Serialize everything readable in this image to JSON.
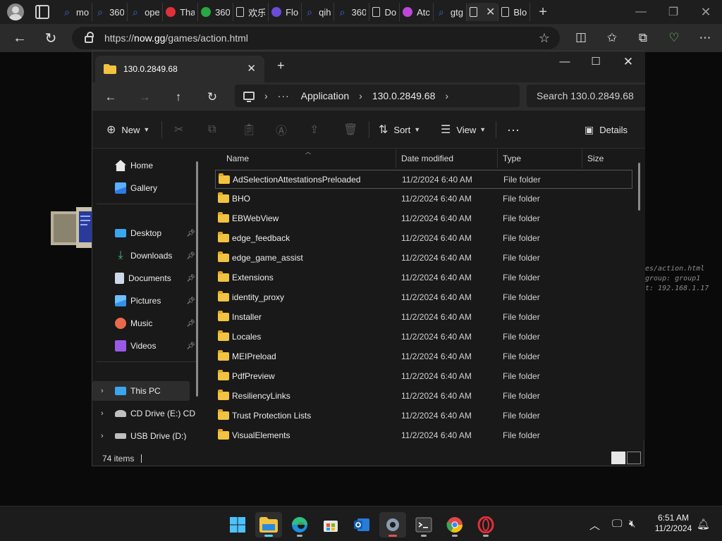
{
  "browser": {
    "tabs": [
      {
        "label": "mo",
        "icon": "search-icon",
        "color": "#3c6fd8"
      },
      {
        "label": "360",
        "icon": "search-icon",
        "color": "#3c6fd8"
      },
      {
        "label": "ope",
        "icon": "search-icon",
        "color": "#3c6fd8"
      },
      {
        "label": "Tha",
        "icon": "opera-icon",
        "color": "#e0303a"
      },
      {
        "label": "360",
        "icon": "chatgpt-icon",
        "color": "#28a745"
      },
      {
        "label": "欢乐",
        "icon": "page-icon",
        "color": "#cfcfcf"
      },
      {
        "label": "Flo",
        "icon": "flo-icon",
        "color": "#6a4cd8"
      },
      {
        "label": "qih",
        "icon": "search-icon",
        "color": "#3c6fd8"
      },
      {
        "label": "360",
        "icon": "search-icon",
        "color": "#3c6fd8"
      },
      {
        "label": "Do",
        "icon": "page-icon",
        "color": "#cfcfcf"
      },
      {
        "label": "Atc",
        "icon": "copilot-icon",
        "color": "#c046d8"
      },
      {
        "label": "gtg",
        "icon": "search-icon",
        "color": "#3c6fd8"
      },
      {
        "label": "Blo",
        "icon": "page-icon",
        "color": "#cfcfcf"
      }
    ],
    "url_prefix": "https://",
    "url_host": "now.gg",
    "url_path": "/games/action.html"
  },
  "page": {
    "side_text": [
      "es/action.html",
      "group: group1",
      "t: 192.168.1.17"
    ]
  },
  "explorer": {
    "tab_title": "130.0.2849.68",
    "breadcrumb": [
      "Application",
      "130.0.2849.68"
    ],
    "search_placeholder": "Search 130.0.2849.68",
    "commands": {
      "new": "New",
      "sort": "Sort",
      "view": "View",
      "details": "Details"
    },
    "nav": {
      "home": "Home",
      "gallery": "Gallery",
      "desktop": "Desktop",
      "downloads": "Downloads",
      "documents": "Documents",
      "pictures": "Pictures",
      "music": "Music",
      "videos": "Videos",
      "this_pc": "This PC",
      "cd_drive": "CD Drive (E:) CD",
      "usb_drive": "USB Drive (D:)"
    },
    "columns": {
      "name": "Name",
      "date": "Date modified",
      "type": "Type",
      "size": "Size"
    },
    "rows": [
      {
        "name": "AdSelectionAttestationsPreloaded",
        "date": "11/2/2024 6:40 AM",
        "type": "File folder"
      },
      {
        "name": "BHO",
        "date": "11/2/2024 6:40 AM",
        "type": "File folder"
      },
      {
        "name": "EBWebView",
        "date": "11/2/2024 6:40 AM",
        "type": "File folder"
      },
      {
        "name": "edge_feedback",
        "date": "11/2/2024 6:40 AM",
        "type": "File folder"
      },
      {
        "name": "edge_game_assist",
        "date": "11/2/2024 6:40 AM",
        "type": "File folder"
      },
      {
        "name": "Extensions",
        "date": "11/2/2024 6:40 AM",
        "type": "File folder"
      },
      {
        "name": "identity_proxy",
        "date": "11/2/2024 6:40 AM",
        "type": "File folder"
      },
      {
        "name": "Installer",
        "date": "11/2/2024 6:40 AM",
        "type": "File folder"
      },
      {
        "name": "Locales",
        "date": "11/2/2024 6:40 AM",
        "type": "File folder"
      },
      {
        "name": "MEIPreload",
        "date": "11/2/2024 6:40 AM",
        "type": "File folder"
      },
      {
        "name": "PdfPreview",
        "date": "11/2/2024 6:40 AM",
        "type": "File folder"
      },
      {
        "name": "ResiliencyLinks",
        "date": "11/2/2024 6:40 AM",
        "type": "File folder"
      },
      {
        "name": "Trust Protection Lists",
        "date": "11/2/2024 6:40 AM",
        "type": "File folder"
      },
      {
        "name": "VisualElements",
        "date": "11/2/2024 6:40 AM",
        "type": "File folder"
      }
    ],
    "status": {
      "count": "74 items"
    }
  },
  "taskbar": {
    "time": "6:51 AM",
    "date": "11/2/2024"
  }
}
